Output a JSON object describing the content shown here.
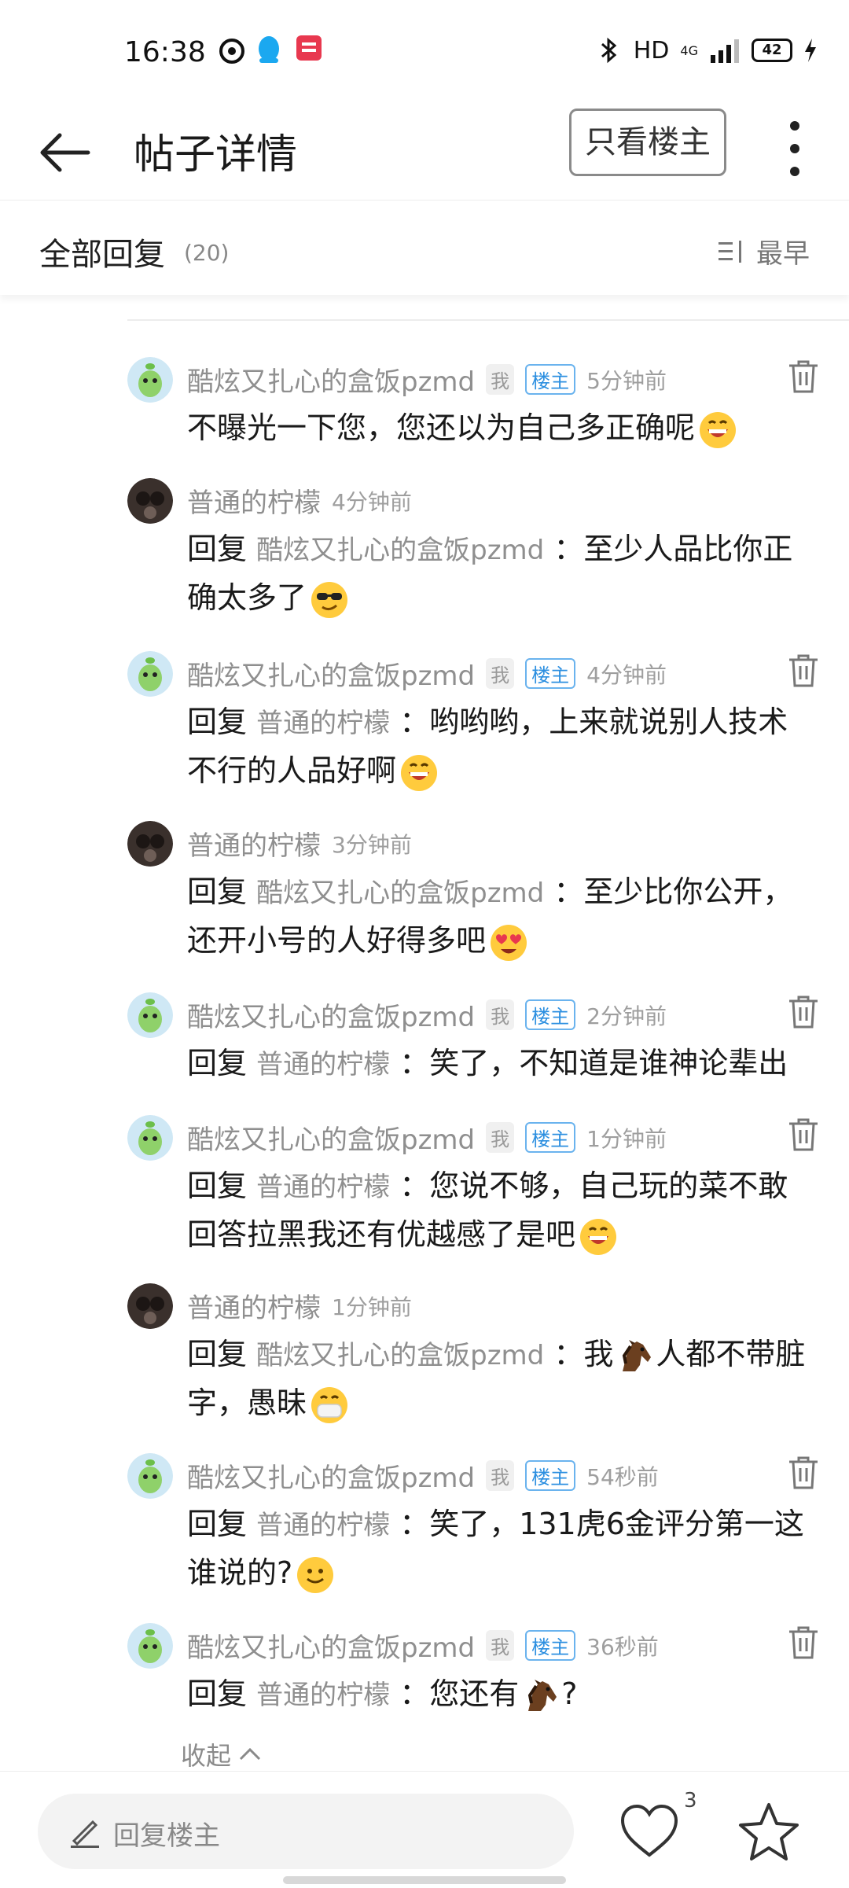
{
  "status_bar": {
    "time": "16:38",
    "network": "HD",
    "signal": "4G",
    "battery": "42"
  },
  "app_bar": {
    "title": "帖子详情",
    "op_only_label": "只看楼主"
  },
  "section": {
    "title": "全部回复",
    "count": "(20)",
    "sort_label": "最早"
  },
  "labels": {
    "me": "我",
    "op": "楼主",
    "reply": "回复"
  },
  "users": {
    "a": "酷炫又扎心的盒饭pzmd",
    "b": "普通的柠檬"
  },
  "comments": [
    {
      "user": "酷炫又扎心的盒饭pzmd",
      "time": "5分钟前",
      "text": "不曝光一下您，您还以为自己多正确呢"
    },
    {
      "user": "普通的柠檬",
      "time": "4分钟前",
      "reply_to": "酷炫又扎心的盒饭pzmd",
      "text": "：至少人品比你正确太多了"
    },
    {
      "user": "酷炫又扎心的盒饭pzmd",
      "time": "4分钟前",
      "reply_to": "普通的柠檬",
      "text": "：哟哟哟，上来就说别人技术不行的人品好啊"
    },
    {
      "user": "普通的柠檬",
      "time": "3分钟前",
      "reply_to": "酷炫又扎心的盒饭pzmd",
      "text": "：至少比你公开，还开小号的人好得多吧"
    },
    {
      "user": "酷炫又扎心的盒饭pzmd",
      "time": "2分钟前",
      "reply_to": "普通的柠檬",
      "text": "：笑了，不知道是谁神论辈出"
    },
    {
      "user": "酷炫又扎心的盒饭pzmd",
      "time": "1分钟前",
      "reply_to": "普通的柠檬",
      "text": "：您说不够，自己玩的菜不敢回答拉黑我还有优越感了是吧"
    },
    {
      "user": "普通的柠檬",
      "time": "1分钟前",
      "reply_to": "酷炫又扎心的盒饭pzmd",
      "text_a": "：我",
      "text_b": "人都不带脏字，愚昧"
    },
    {
      "user": "酷炫又扎心的盒饭pzmd",
      "time": "54秒前",
      "reply_to": "普通的柠檬",
      "text": "：笑了，131虎6金评分第一这谁说的?"
    },
    {
      "user": "酷炫又扎心的盒饭pzmd",
      "time": "36秒前",
      "reply_to": "普通的柠檬",
      "text_a": "：您还有",
      "text_b": "?"
    }
  ],
  "collapse_label": "收起",
  "bottom": {
    "reply_placeholder": "回复楼主",
    "like_count": "3"
  },
  "colors": {
    "op_tag": "#2c8fe0",
    "muted": "#8f8f8f"
  }
}
